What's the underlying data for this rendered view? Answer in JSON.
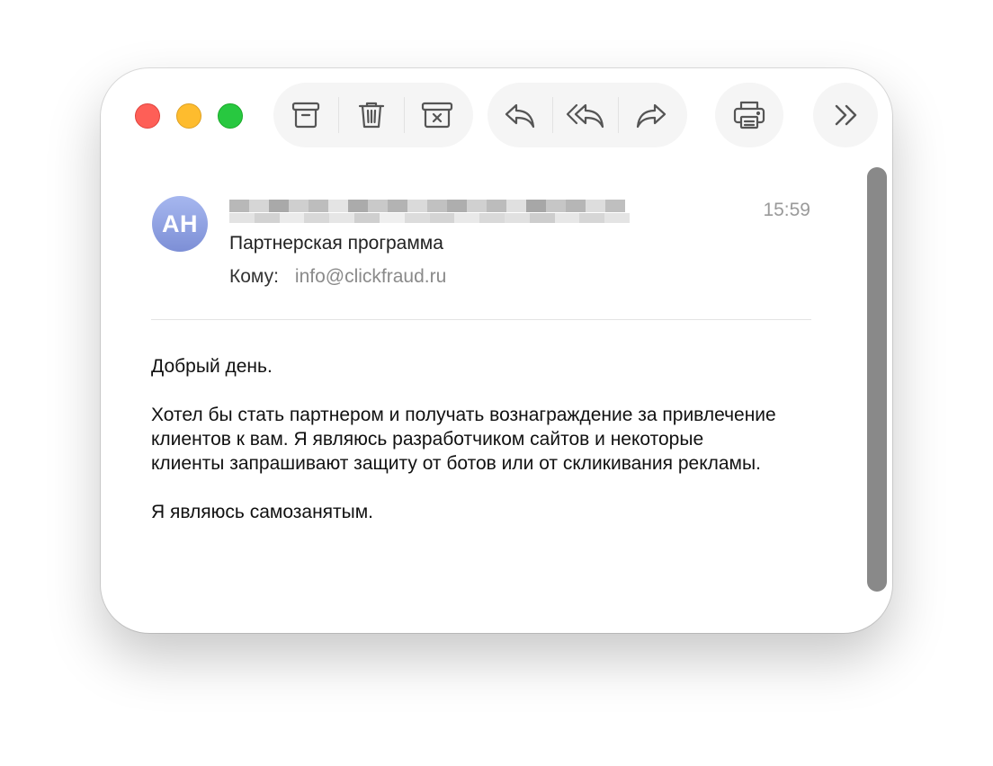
{
  "toolbar": {
    "icons": [
      "archive-icon",
      "trash-icon",
      "junk-icon",
      "reply-icon",
      "reply-all-icon",
      "forward-icon",
      "print-icon",
      "more-icon"
    ]
  },
  "message": {
    "avatar_initials": "AH",
    "time": "15:59",
    "subject": "Партнерская программа",
    "to_label": "Кому:",
    "to_address": "info@clickfraud.ru",
    "body": [
      "Добрый день.",
      "Хотел бы стать партнером и получать вознаграждение за привлечение клиентов к вам. Я являюсь разработчиком сайтов и некоторые клиенты запрашивают защиту от ботов или от скликивания рекламы.",
      "Я являюсь самозанятым."
    ]
  },
  "colors": {
    "close": "#fe5f57",
    "minimize": "#febc2e",
    "zoom": "#28c840",
    "avatar": "#8d9fe0"
  }
}
